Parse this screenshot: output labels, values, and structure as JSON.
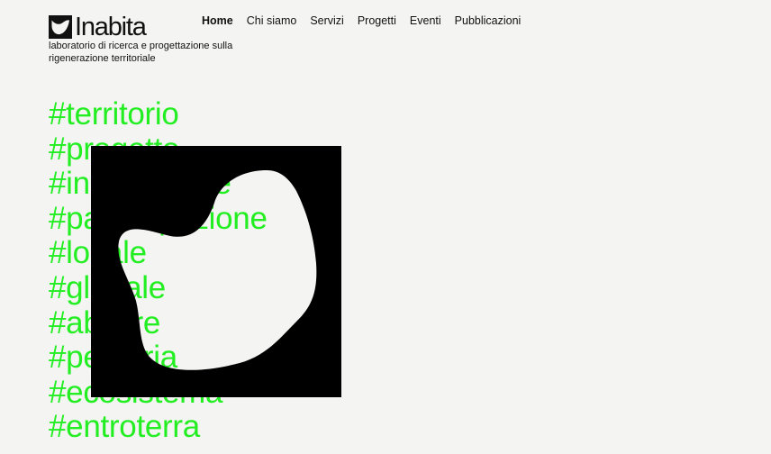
{
  "brand": {
    "name": "Inabita",
    "tagline": "laboratorio di ricerca e progettazione sulla rigenerazione territoriale"
  },
  "nav": {
    "items": [
      {
        "label": "Home",
        "active": true
      },
      {
        "label": "Chi siamo",
        "active": false
      },
      {
        "label": "Servizi",
        "active": false
      },
      {
        "label": "Progetti",
        "active": false
      },
      {
        "label": "Eventi",
        "active": false
      },
      {
        "label": "Pubblicazioni",
        "active": false
      }
    ]
  },
  "tags": [
    "#territorio",
    "#progetto",
    "#innovazione",
    "#partecipazione",
    "#locale",
    "#globale",
    "#abitare",
    "#periferia",
    "#ecosistema",
    "#entroterra"
  ],
  "colors": {
    "background": "#f4f4f2",
    "accent_green": "#22ee22",
    "ink": "#111111"
  },
  "icons": {
    "logo_mark": "bird-shape-icon",
    "hero_art": "blob-cutout-square"
  }
}
